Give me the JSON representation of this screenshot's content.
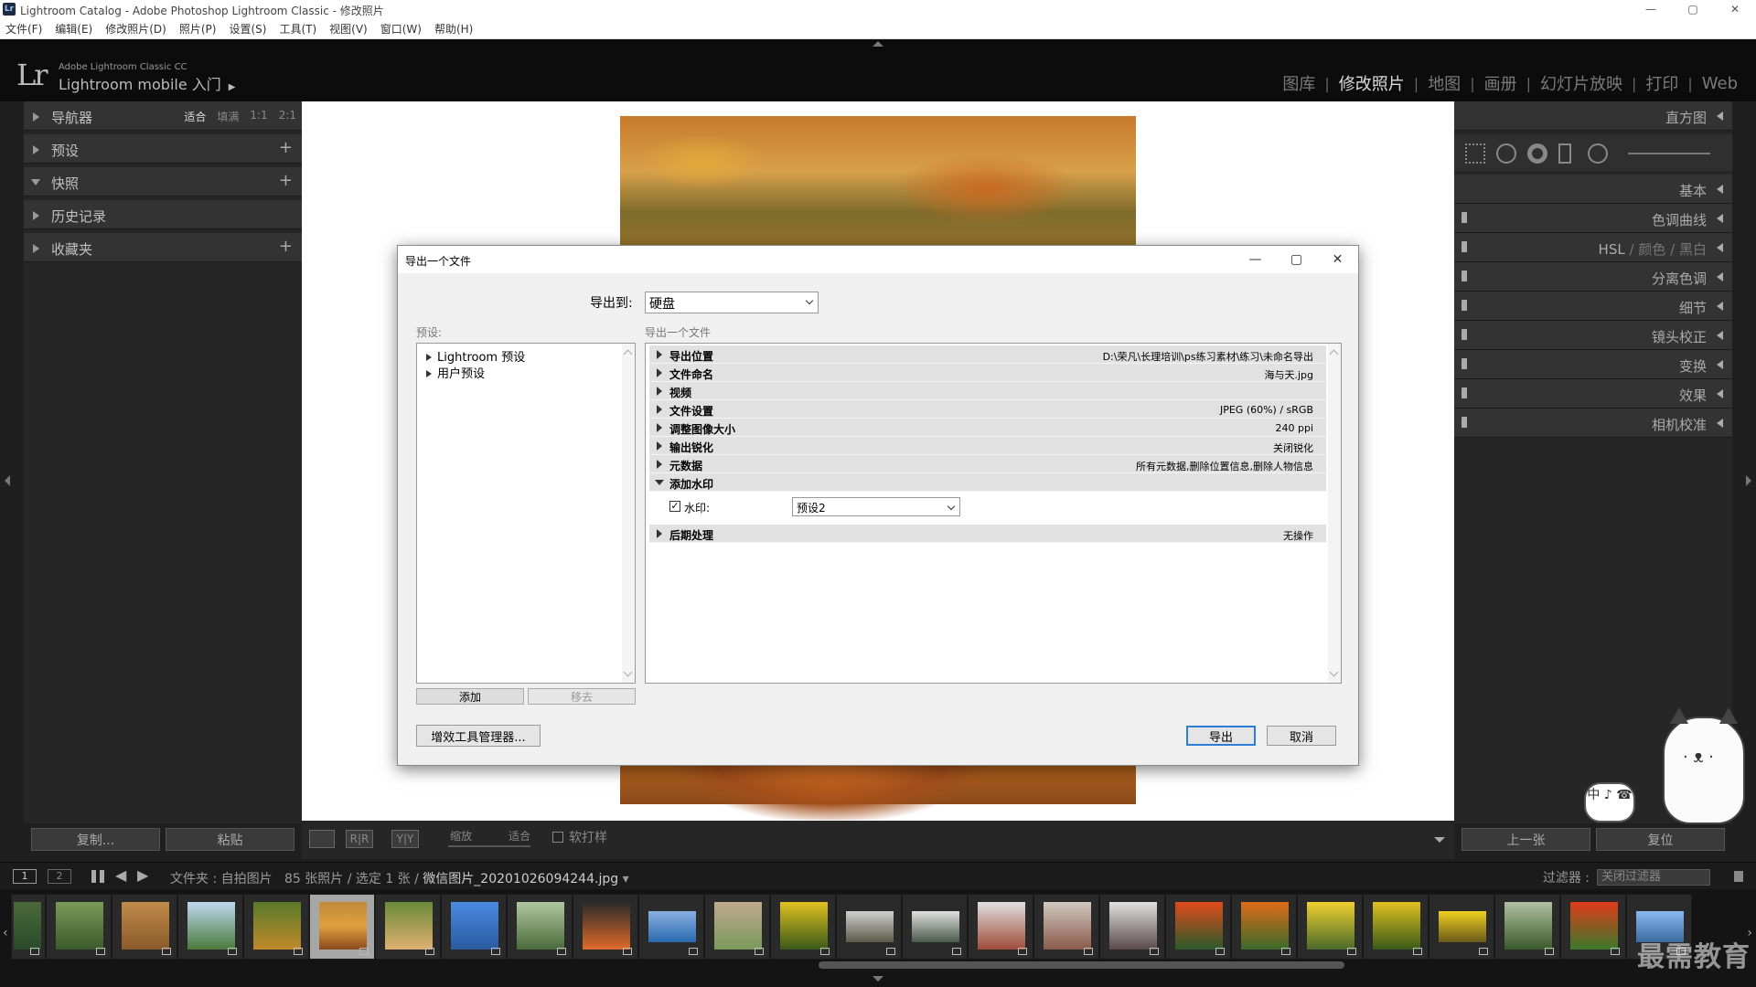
{
  "window": {
    "title": "Lightroom Catalog - Adobe Photoshop Lightroom Classic - 修改照片",
    "badge": "Lr",
    "controls": [
      "—",
      "▢",
      "✕"
    ]
  },
  "menu": [
    "文件(F)",
    "编辑(E)",
    "修改照片(D)",
    "照片(P)",
    "设置(S)",
    "工具(T)",
    "视图(V)",
    "窗口(W)",
    "帮助(H)"
  ],
  "brand": {
    "logo": "Lr",
    "small": "Adobe Lightroom Classic CC",
    "big": "Lightroom mobile 入门",
    "arrow": "▶"
  },
  "modules": [
    {
      "label": "图库",
      "active": false
    },
    {
      "label": "修改照片",
      "active": true
    },
    {
      "label": "地图",
      "active": false
    },
    {
      "label": "画册",
      "active": false
    },
    {
      "label": "幻灯片放映",
      "active": false
    },
    {
      "label": "打印",
      "active": false
    },
    {
      "label": "Web",
      "active": false
    }
  ],
  "left_panel": {
    "navigator": {
      "label": "导航器",
      "opts": [
        "适合",
        "填满",
        "1:1",
        "2:1"
      ],
      "selected": "适合"
    },
    "presets": "预设",
    "snapshots": "快照",
    "history": "历史记录",
    "collections": "收藏夹",
    "plus": "+",
    "copy_button": "复制...",
    "paste_button": "粘贴"
  },
  "right_panel": {
    "histogram": "直方图",
    "basic": "基本",
    "tone_curve": "色调曲线",
    "hsl": "HSL",
    "hsl_sep": "/",
    "color": "颜色",
    "bw": "黑白",
    "split_toning": "分离色调",
    "detail": "细节",
    "lens": "镜头校正",
    "transform": "变换",
    "effects": "效果",
    "calibration": "相机校准",
    "prev_button": "上一张",
    "reset_button": "复位"
  },
  "center_toolbar": {
    "zoom_label": "缩放",
    "zoom_value": "适合",
    "softproof": "软打样",
    "rr": "R|R",
    "yy": "Y|Y"
  },
  "filmstrip_bar": {
    "screen1": "1",
    "screen2": "2",
    "path_prefix": "文件夹 : 自拍图片",
    "count": "85 张照片 / 选定 1 张 /",
    "filename": "微信图片_20201026094244.jpg",
    "filter_label": "过滤器 :",
    "filter_value": "关闭过滤器"
  },
  "dialog": {
    "title": "导出一个文件",
    "export_to_label": "导出到:",
    "export_to_value": "硬盘",
    "preset_label": "预设:",
    "section_label": "导出一个文件",
    "presets": [
      "Lightroom 预设",
      "用户预设"
    ],
    "add_button": "添加",
    "remove_button": "移去",
    "plugin_button": "增效工具管理器...",
    "export_button": "导出",
    "cancel_button": "取消",
    "sections": [
      {
        "name": "导出位置",
        "value": "D:\\荣凡\\长理培训\\ps练习素材\\练习\\未命名导出",
        "expanded": false
      },
      {
        "name": "文件命名",
        "value": "海与天.jpg",
        "expanded": false
      },
      {
        "name": "视频",
        "value": "",
        "expanded": false
      },
      {
        "name": "文件设置",
        "value": "JPEG (60%) / sRGB",
        "expanded": false
      },
      {
        "name": "调整图像大小",
        "value": "240 ppi",
        "expanded": false
      },
      {
        "name": "输出锐化",
        "value": "关闭锐化",
        "expanded": false
      },
      {
        "name": "元数据",
        "value": "所有元数据,删除位置信息,删除人物信息",
        "expanded": false
      },
      {
        "name": "添加水印",
        "value": "",
        "expanded": true
      }
    ],
    "post_processing": {
      "name": "后期处理",
      "value": "无操作"
    },
    "watermark": {
      "checked": true,
      "label": "水印:",
      "value": "预设2",
      "check_glyph": "✓"
    }
  },
  "watermark_overlay": {
    "text": "最需教育",
    "bubble": "中 ♪ ☎"
  },
  "colors": {
    "accent": "#2a7fd4",
    "panel_bg": "#262626",
    "top_bg": "#0c0c0c"
  }
}
